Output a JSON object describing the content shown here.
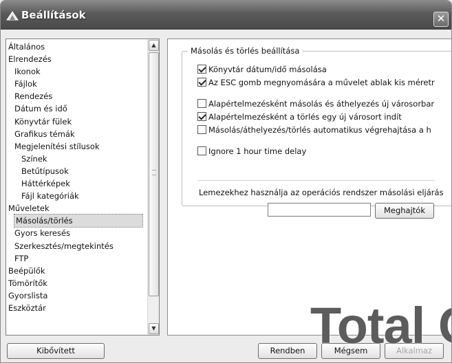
{
  "window": {
    "title": "Beállítások",
    "close_glyph": "✕"
  },
  "tree": {
    "items": [
      {
        "label": "Általános",
        "level": 0
      },
      {
        "label": "Elrendezés",
        "level": 0
      },
      {
        "label": "Ikonok",
        "level": 1
      },
      {
        "label": "Fájlok",
        "level": 1
      },
      {
        "label": "Rendezés",
        "level": 1
      },
      {
        "label": "Dátum és idő",
        "level": 1
      },
      {
        "label": "Könyvtár fülek",
        "level": 1
      },
      {
        "label": "Grafikus témák",
        "level": 1
      },
      {
        "label": "Megjelenítési stílusok",
        "level": 1
      },
      {
        "label": "Színek",
        "level": 2
      },
      {
        "label": "Betűtípusok",
        "level": 2
      },
      {
        "label": "Háttérképek",
        "level": 2
      },
      {
        "label": "Fájl kategóriák",
        "level": 2
      },
      {
        "label": "Műveletek",
        "level": 0
      },
      {
        "label": "Másolás/törlés",
        "level": 1,
        "selected": true
      },
      {
        "label": "Gyors keresés",
        "level": 1
      },
      {
        "label": "Szerkesztés/megtekintés",
        "level": 1
      },
      {
        "label": "FTP",
        "level": 1
      },
      {
        "label": "Beépülők",
        "level": 0
      },
      {
        "label": "Tömörítők",
        "level": 0
      },
      {
        "label": "Gyorslista",
        "level": 0
      },
      {
        "label": "Eszköztár",
        "level": 0
      }
    ],
    "scroll_up_glyph": "▲",
    "scroll_down_glyph": "▼"
  },
  "panel": {
    "group_title": "Másolás és törlés beállítása",
    "options": [
      {
        "label": "Könyvtár dátum/idő másolása",
        "checked": true
      },
      {
        "label": "Az ESC gomb megnyomására a művelet ablak kis méretr",
        "checked": true
      },
      {
        "label": "Alapértelmezésként másolás és áthelyezés új városorbar",
        "checked": false
      },
      {
        "label": "Alapértelmezésként a törlés egy új városort indít",
        "checked": true
      },
      {
        "label": "Másolás/áthelyezés/törlés automatikus végrehajtása a h",
        "checked": false
      },
      {
        "label": "Ignore 1 hour time delay",
        "checked": false
      }
    ],
    "lemez_label": "Lemezekhez használja az operációs rendszer másolási eljárás",
    "lemez_value": "",
    "meghajtok_label": "Meghajtók"
  },
  "footer": {
    "kibovitett_label": "Kibővített",
    "rendben_label": "Rendben",
    "megsem_label": "Mégsem",
    "alkalmaz_label": "Alkalmaz"
  },
  "watermark": "Total C"
}
